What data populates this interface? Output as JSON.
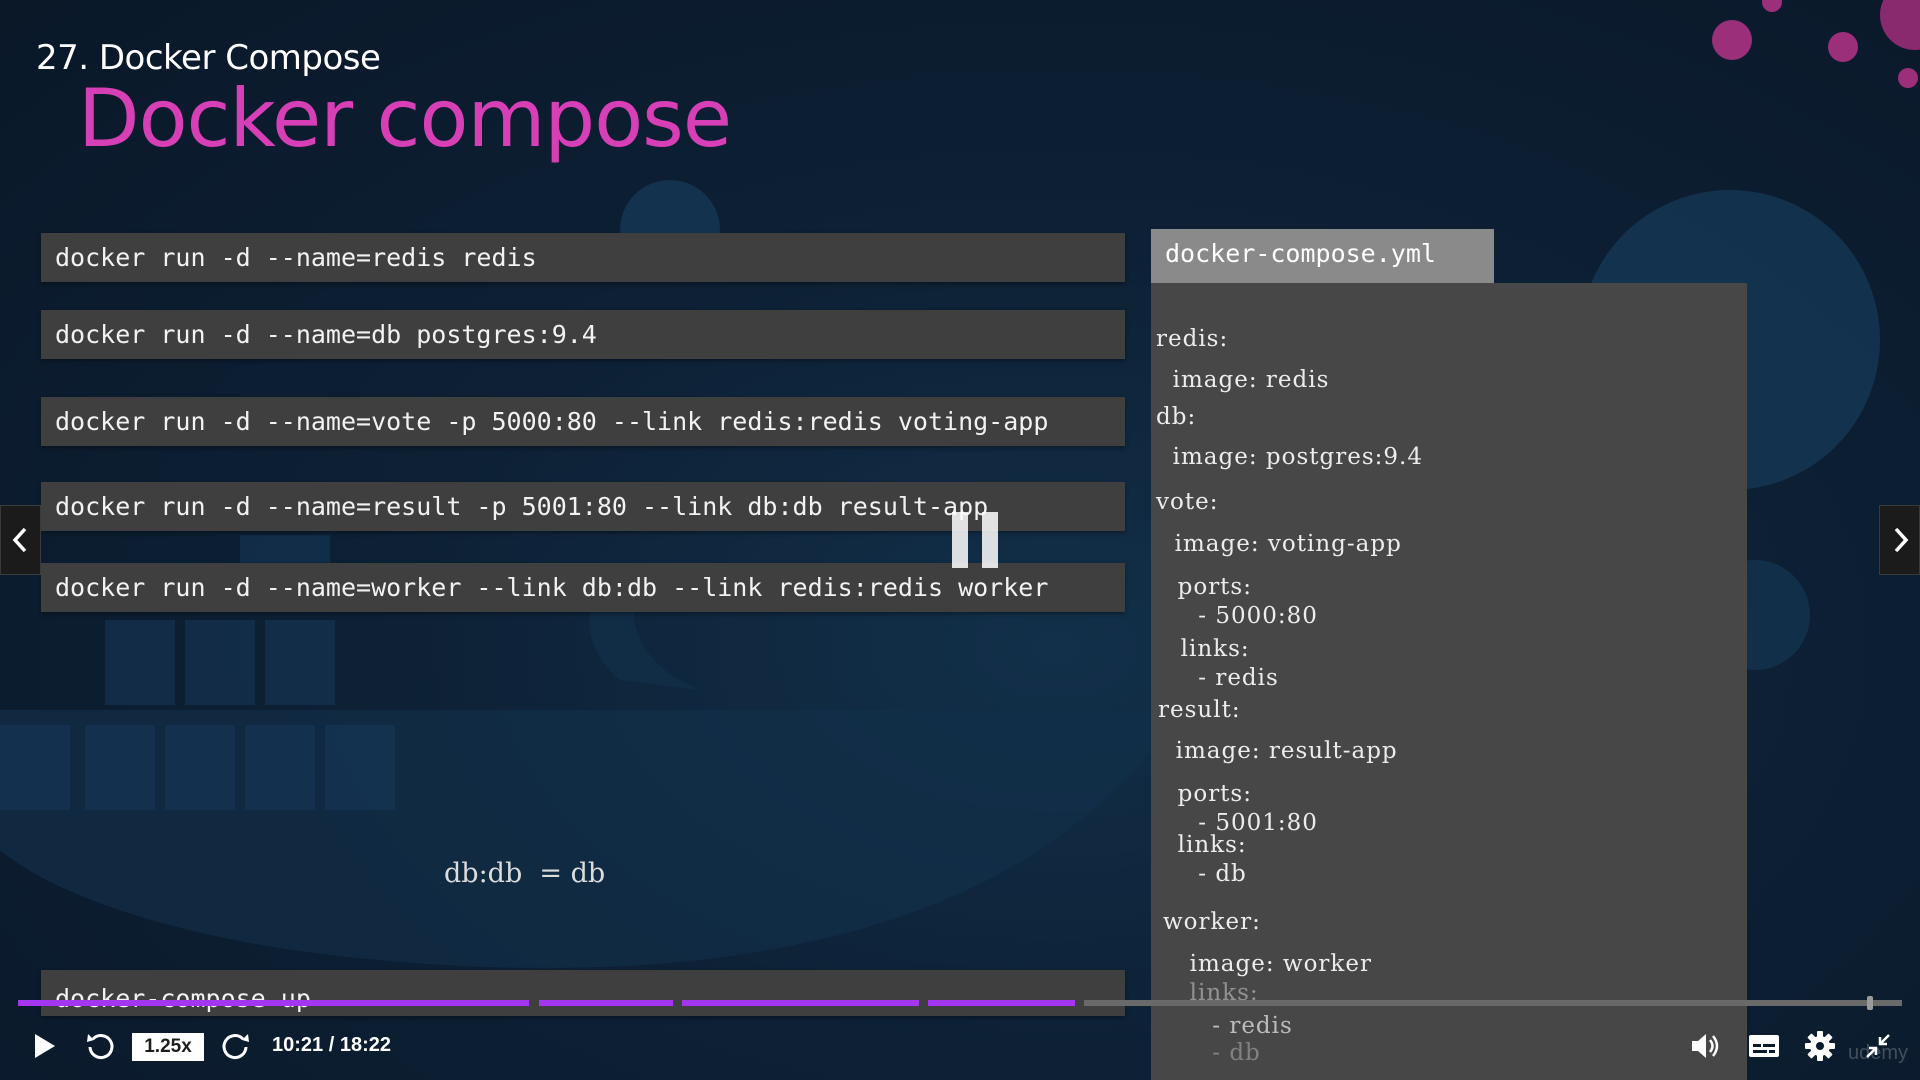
{
  "lecture": {
    "title": "27. Docker Compose"
  },
  "slide": {
    "title": "Docker compose",
    "commands": [
      "docker run -d --name=redis redis",
      "docker run -d --name=db postgres:9.4",
      "docker run -d --name=vote -p 5000:80 --link redis:redis voting-app",
      "docker run -d --name=result -p 5001:80 --link db:db result-app",
      "docker run -d --name=worker --link db:db --link redis:redis worker",
      "docker-compose up"
    ],
    "equation": "db:db  = db",
    "yml_tab": "docker-compose.yml",
    "yml_lines": [
      "redis:",
      "  image: redis",
      "db:",
      "  image: postgres:9.4",
      "vote:",
      "  image: voting-app",
      "  ports:",
      "    - 5000:80",
      "  links:",
      "    - redis",
      "result:",
      "  image: result-app",
      "  ports:",
      "    - 5001:80",
      "  links:",
      "    - db",
      "worker:",
      "  image: worker",
      "  links:",
      "    - redis",
      "    - db"
    ]
  },
  "player": {
    "speed": "1.25x",
    "time": "10:21 / 18:22",
    "progress_fraction": 0.565,
    "watermark": "udemy",
    "accent_color": "#a435f0",
    "icons": {
      "play": "play-icon",
      "rewind": "rewind-5s-icon",
      "forward": "forward-5s-icon",
      "volume": "volume-icon",
      "captions": "captions-icon",
      "settings": "gear-icon",
      "fullscreen": "exit-fullscreen-icon",
      "prev": "chevron-left-icon",
      "next": "chevron-right-icon",
      "pause_overlay": "pause-icon"
    }
  }
}
